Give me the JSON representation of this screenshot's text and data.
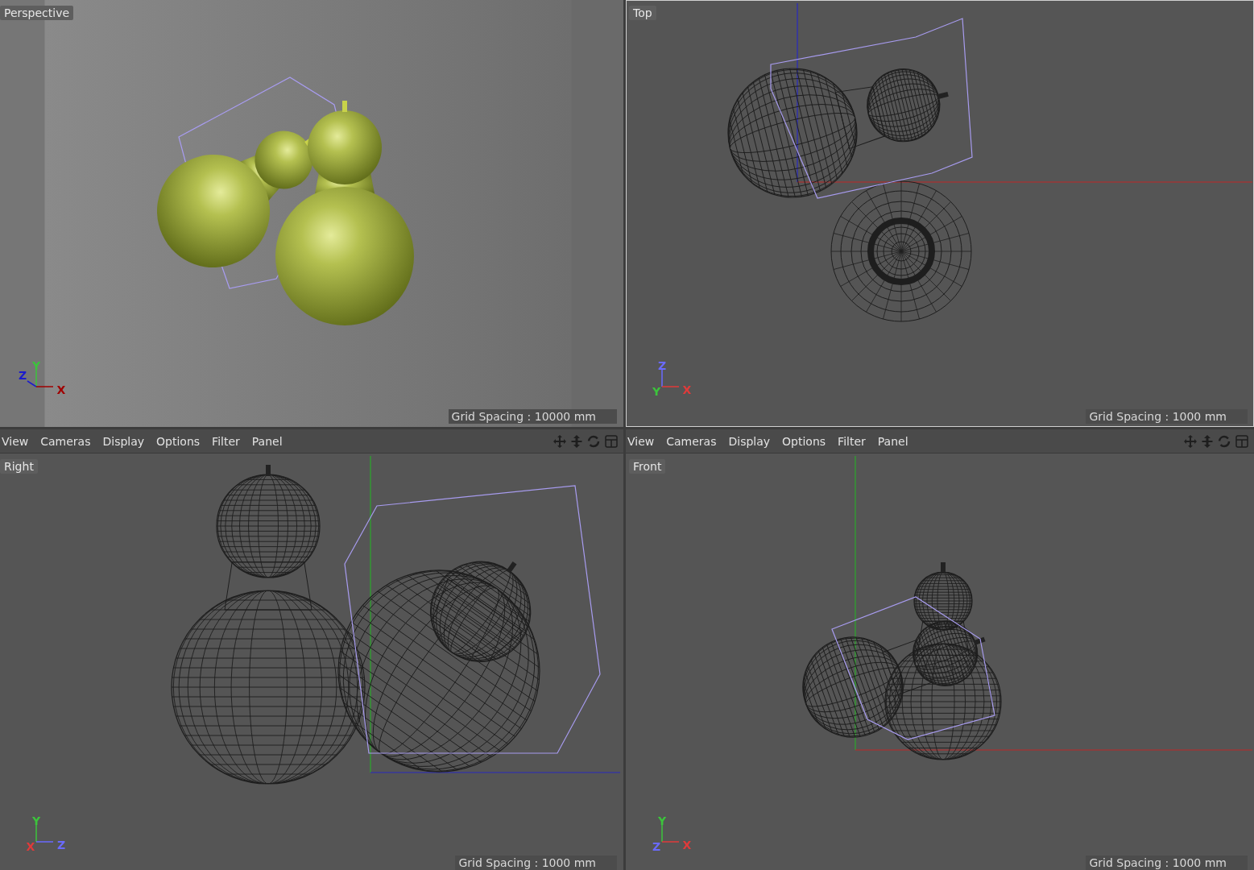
{
  "viewports": [
    {
      "label": "Perspective",
      "kind": "shaded",
      "selected": false,
      "grid_spacing": "Grid Spacing : 10000 mm",
      "axes": [
        {
          "label": "Y",
          "color": "#3cc43c",
          "kind": "up"
        },
        {
          "label": "Z",
          "color": "#1c1ccc",
          "kind": "left"
        },
        {
          "label": "X",
          "color": "#a00000",
          "kind": "right"
        }
      ]
    },
    {
      "label": "Top",
      "kind": "wireframe",
      "selected": true,
      "grid_spacing": "Grid Spacing : 1000 mm",
      "axes": [
        {
          "label": "Z",
          "color": "#6a6aff",
          "kind": "up"
        },
        {
          "label": "Y",
          "color": "#3cc43c",
          "kind": "origin"
        },
        {
          "label": "X",
          "color": "#e03a3a",
          "kind": "right"
        }
      ]
    },
    {
      "label": "Right",
      "kind": "wireframe",
      "selected": false,
      "menu": [
        "View",
        "Cameras",
        "Display",
        "Options",
        "Filter",
        "Panel"
      ],
      "grid_spacing": "Grid Spacing : 1000 mm",
      "axes": [
        {
          "label": "Y",
          "color": "#3cc43c",
          "kind": "up"
        },
        {
          "label": "X",
          "color": "#e03a3a",
          "kind": "origin"
        },
        {
          "label": "Z",
          "color": "#6a6aff",
          "kind": "right"
        }
      ]
    },
    {
      "label": "Front",
      "kind": "wireframe",
      "selected": false,
      "menu": [
        "View",
        "Cameras",
        "Display",
        "Options",
        "Filter",
        "Panel"
      ],
      "grid_spacing": "Grid Spacing : 1000 mm",
      "axes": [
        {
          "label": "Y",
          "color": "#3cc43c",
          "kind": "up"
        },
        {
          "label": "Z",
          "color": "#6a6aff",
          "kind": "origin"
        },
        {
          "label": "X",
          "color": "#e03a3a",
          "kind": "right"
        }
      ]
    }
  ]
}
